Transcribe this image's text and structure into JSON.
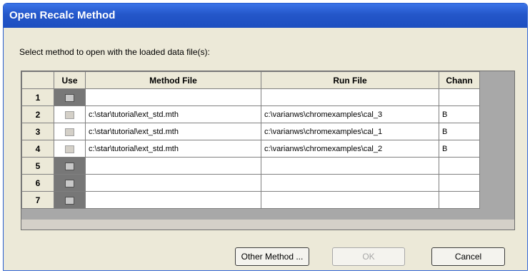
{
  "window": {
    "title": "Open Recalc Method"
  },
  "prompt": "Select method to open with the loaded data file(s):",
  "columns": [
    "",
    "Use",
    "Method File",
    "Run File",
    "Chann"
  ],
  "rows": [
    {
      "num": "1",
      "method": "",
      "run": "",
      "chan": "",
      "use_dark": true
    },
    {
      "num": "2",
      "method": "c:\\star\\tutorial\\ext_std.mth",
      "run": "c:\\varianws\\chromexamples\\cal_3",
      "chan": "B",
      "use_dark": false
    },
    {
      "num": "3",
      "method": "c:\\star\\tutorial\\ext_std.mth",
      "run": "c:\\varianws\\chromexamples\\cal_1",
      "chan": "B",
      "use_dark": false
    },
    {
      "num": "4",
      "method": "c:\\star\\tutorial\\ext_std.mth",
      "run": "c:\\varianws\\chromexamples\\cal_2",
      "chan": "B",
      "use_dark": false
    },
    {
      "num": "5",
      "method": "",
      "run": "",
      "chan": "",
      "use_dark": true
    },
    {
      "num": "6",
      "method": "",
      "run": "",
      "chan": "",
      "use_dark": true
    },
    {
      "num": "7",
      "method": "",
      "run": "",
      "chan": "",
      "use_dark": true
    }
  ],
  "buttons": {
    "other_method": "Other Method ...",
    "ok": "OK",
    "cancel": "Cancel"
  }
}
